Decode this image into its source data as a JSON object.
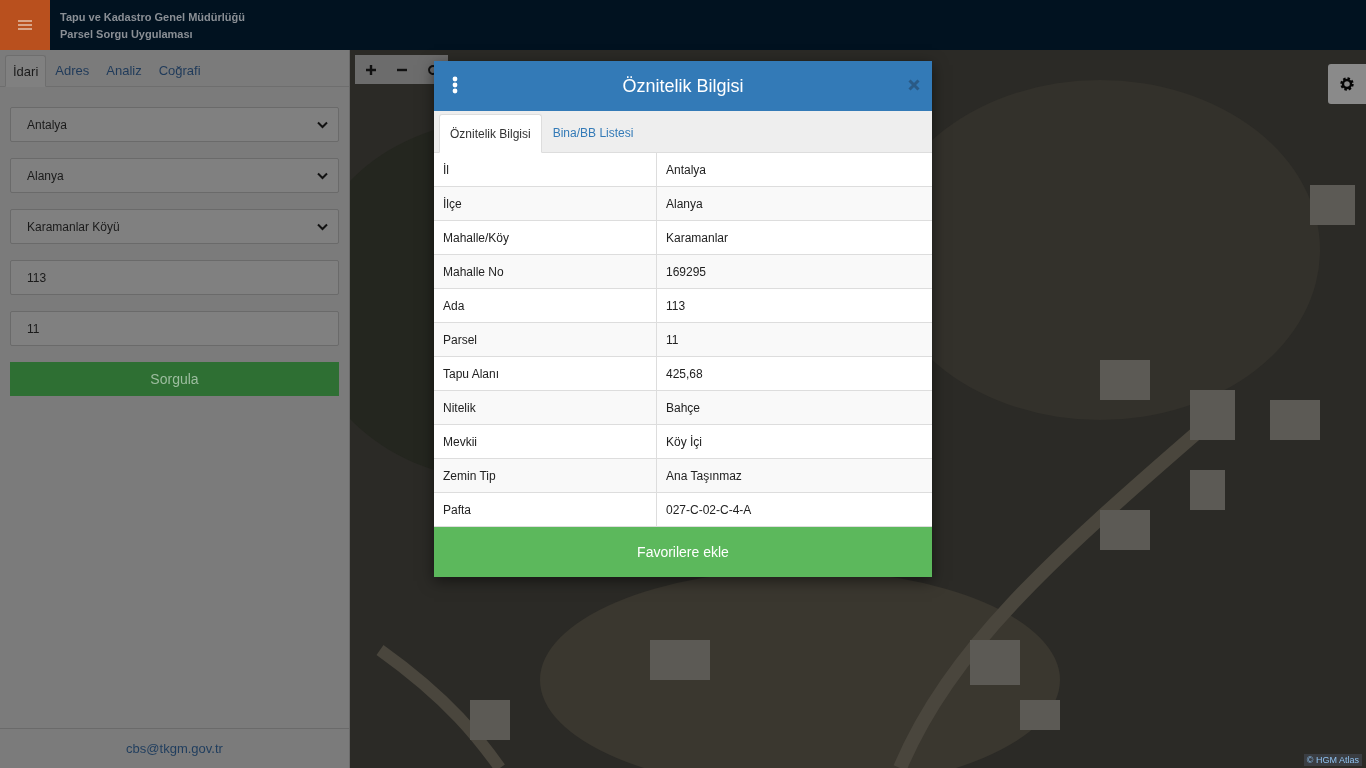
{
  "header": {
    "title": "Tapu ve Kadastro Genel Müdürlüğü",
    "subtitle": "Parsel Sorgu Uygulaması"
  },
  "sidebar": {
    "tabs": [
      {
        "label": "İdari",
        "selected": true
      },
      {
        "label": "Adres",
        "selected": false
      },
      {
        "label": "Analiz",
        "selected": false
      },
      {
        "label": "Coğrafi",
        "selected": false
      }
    ],
    "fields": [
      {
        "kind": "select",
        "value": "Antalya"
      },
      {
        "kind": "select",
        "value": "Alanya"
      },
      {
        "kind": "select",
        "value": "Karamanlar Köyü"
      },
      {
        "kind": "input",
        "value": "113"
      },
      {
        "kind": "input",
        "value": "11"
      }
    ],
    "query_button": "Sorgula",
    "footer_email": "cbs@tkgm.gov.tr"
  },
  "modal": {
    "title": "Öznitelik Bilgisi",
    "tabs": [
      {
        "label": "Öznitelik Bilgisi",
        "selected": true
      },
      {
        "label": "Bina/BB Listesi",
        "selected": false
      }
    ],
    "rows": [
      {
        "label": "İl",
        "value": "Antalya"
      },
      {
        "label": "İlçe",
        "value": "Alanya"
      },
      {
        "label": "Mahalle/Köy",
        "value": "Karamanlar"
      },
      {
        "label": "Mahalle No",
        "value": "169295"
      },
      {
        "label": "Ada",
        "value": "113"
      },
      {
        "label": "Parsel",
        "value": "11"
      },
      {
        "label": "Tapu Alanı",
        "value": "425,68"
      },
      {
        "label": "Nitelik",
        "value": "Bahçe"
      },
      {
        "label": "Mevkii",
        "value": "Köy İçi"
      },
      {
        "label": "Zemin Tip",
        "value": "Ana Taşınmaz"
      },
      {
        "label": "Pafta",
        "value": "027-C-02-C-4-A"
      }
    ],
    "favorite_button": "Favorilere ekle"
  },
  "map": {
    "attribution": "© HGM Atlas"
  }
}
